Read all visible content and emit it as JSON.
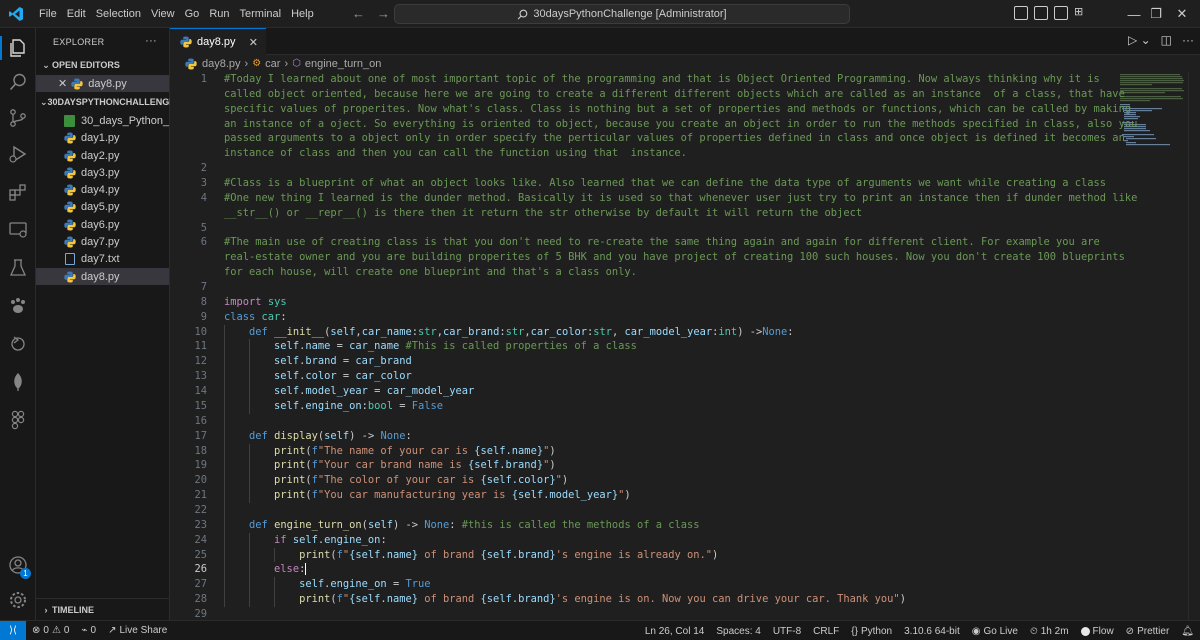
{
  "menu": [
    "File",
    "Edit",
    "Selection",
    "View",
    "Go",
    "Run",
    "Terminal",
    "Help"
  ],
  "title": "30daysPythonChallenge [Administrator]",
  "explorer": {
    "header": "EXPLORER",
    "open_editors_label": "OPEN EDITORS",
    "open_editor_file": "day8.py",
    "folder_label": "30DAYSPYTHONCHALLENGE",
    "files": [
      "30_days_Python_...",
      "day1.py",
      "day2.py",
      "day3.py",
      "day4.py",
      "day5.py",
      "day6.py",
      "day7.py",
      "day7.txt",
      "day8.py"
    ],
    "timeline_label": "TIMELINE"
  },
  "tab": {
    "label": "day8.py"
  },
  "breadcrumb": {
    "file": "day8.py",
    "cls": "car",
    "method": "engine_turn_on"
  },
  "code_lines": [
    {
      "n": "1",
      "t": "#Today I learned about one of most important topic of the programming and that is Object Oriented Programming. Now always thinking why it is"
    },
    {
      "n": "",
      "t": "called object oriented, because here we are going to create a different different objects which are called as an instance  of a class, that have"
    },
    {
      "n": "",
      "t": "specific values of properites. Now what's class. Class is nothing but a set of properties and methods or functions, which can be called by making"
    },
    {
      "n": "",
      "t": "an instance of a oject. So everything is oriented to object, because you create an object in order to run the methods specified in class, also you"
    },
    {
      "n": "",
      "t": "passed arguments to a object only in order specify the perticular values of properties defined in class and once object is defined it becomes an"
    },
    {
      "n": "",
      "t": "instance of class and then you can call the function using that  instance."
    },
    {
      "n": "2",
      "t": ""
    },
    {
      "n": "3",
      "t": "#Class is a blueprint of what an object looks like. Also learned that we can define the data type of arguments we want while creating a class"
    },
    {
      "n": "4",
      "t": "#One new thing I learned is the dunder method. Basically it is used so that whenever user just try to print an instance then if dunder method like"
    },
    {
      "n": "",
      "t": "__str__() or __repr__() is there then it return the str otherwise by default it will return the object"
    },
    {
      "n": "5",
      "t": ""
    },
    {
      "n": "6",
      "t": "#The main use of creating class is that you don't need to re-create the same thing again and again for different client. For example you are"
    },
    {
      "n": "",
      "t": "real-estate owner and you are building properites of 5 BHK and you have project of creating 100 such houses. Now you don't create 100 blueprints"
    },
    {
      "n": "",
      "t": "for each house, will create one blueprint and that's a class only."
    },
    {
      "n": "7",
      "t": ""
    },
    {
      "n": "8",
      "t": "import sys"
    },
    {
      "n": "9",
      "t": "class car:"
    },
    {
      "n": "10",
      "t": "    def __init__(self,car_name:str,car_brand:str,car_color:str, car_model_year:int) ->None:"
    },
    {
      "n": "11",
      "t": "        self.name = car_name #This is called properties of a class"
    },
    {
      "n": "12",
      "t": "        self.brand = car_brand"
    },
    {
      "n": "13",
      "t": "        self.color = car_color"
    },
    {
      "n": "14",
      "t": "        self.model_year = car_model_year"
    },
    {
      "n": "15",
      "t": "        self.engine_on:bool = False"
    },
    {
      "n": "16",
      "t": ""
    },
    {
      "n": "17",
      "t": "    def display(self) -> None:"
    },
    {
      "n": "18",
      "t": "        print(f\"The name of your car is {self.name}\")"
    },
    {
      "n": "19",
      "t": "        print(f\"Your car brand name is {self.brand}\")"
    },
    {
      "n": "20",
      "t": "        print(f\"The color of your car is {self.color}\")"
    },
    {
      "n": "21",
      "t": "        print(f\"You car manufacturing year is {self.model_year}\")"
    },
    {
      "n": "22",
      "t": ""
    },
    {
      "n": "23",
      "t": "    def engine_turn_on(self) -> None: #this is called the methods of a class"
    },
    {
      "n": "24",
      "t": "        if self.engine_on:"
    },
    {
      "n": "25",
      "t": "            print(f\"{self.name} of brand {self.brand}'s engine is already on.\")"
    },
    {
      "n": "26",
      "t": "        else:"
    },
    {
      "n": "27",
      "t": "            self.engine_on = True"
    },
    {
      "n": "28",
      "t": "            print(f\"{self.name} of brand {self.brand}'s engine is on. Now you can drive your car. Thank you\")"
    },
    {
      "n": "29",
      "t": ""
    }
  ],
  "active_line": "26",
  "status": {
    "errors": "0",
    "warnings": "0",
    "ports": "0",
    "live_share": "Live Share",
    "position": "Ln 26, Col 14",
    "spaces": "Spaces: 4",
    "encoding": "UTF-8",
    "eol": "CRLF",
    "language": "Python",
    "interpreter": "3.10.6 64-bit",
    "go_live": "Go Live",
    "timer": "1h 2m",
    "flow": "Flow",
    "prettier": "Prettier"
  },
  "account_badge": "1",
  "colors": {
    "accent": "#0078d4",
    "comment": "#6a9955",
    "keyword": "#569cd6",
    "string": "#ce9178"
  }
}
